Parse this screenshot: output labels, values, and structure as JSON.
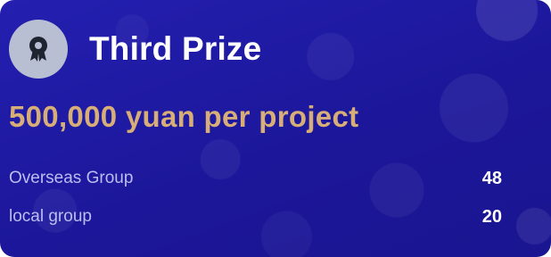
{
  "card": {
    "title": "Third Prize",
    "icon": "award-ribbon-icon",
    "prize_text": "500,000 yuan per project",
    "colors": {
      "background": "#1f1aa0",
      "prize_text": "#d7ad78",
      "badge": "#b9bfd2",
      "icon": "#1e2430"
    },
    "rows": [
      {
        "label": "Overseas Group",
        "value": "48"
      },
      {
        "label": "local group",
        "value": "20"
      }
    ]
  }
}
